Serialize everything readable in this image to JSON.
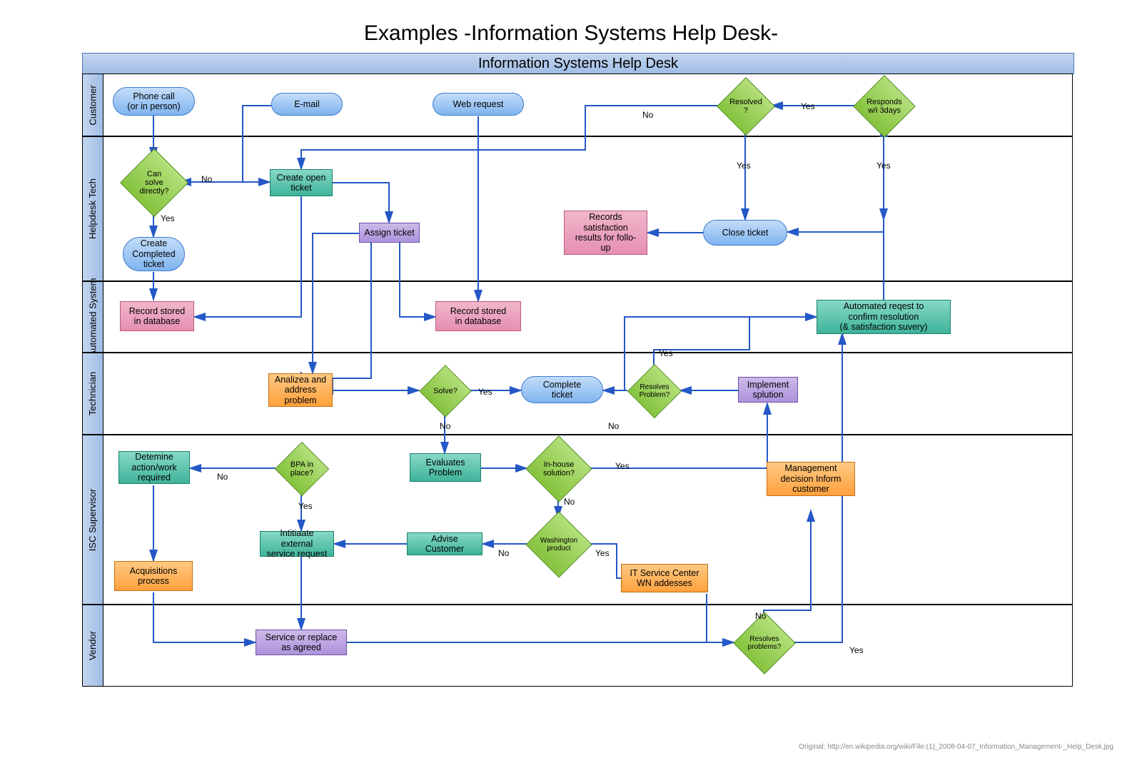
{
  "page_title": "Examples -Information Systems Help Desk-",
  "pool_title": "Information Systems Help Desk",
  "attribution": "Original: http://en.wikipedia.org/wiki/File:(1)_2008-04-07_Information_Management-_Help_Desk.jpg",
  "lanes": {
    "customer": "Customer",
    "helpdesk_tech": "Helpdesk Tech",
    "automated_system": "Automated System",
    "technician": "Technician",
    "isc_supervisor": "ISC Supervisor",
    "vendor": "Vendor"
  },
  "nodes": {
    "phone_call": "Phone call\n(or in person)",
    "email": "E-mail",
    "web_request": "Web request",
    "resolved_q": "Resolved\n?",
    "responds_3days": "Responds\nw/i 3days",
    "can_solve": "Can\nsolve\ndirectly?",
    "create_open_ticket": "Create open\nticket",
    "assign_ticket": "Assign ticket",
    "create_completed_ticket": "Create\nCompleted\nticket",
    "records_satisfaction": "Records\nsatisfaction\nresults for follo-\nup",
    "close_ticket": "Close ticket",
    "record_stored_1": "Record stored\nin database",
    "record_stored_2": "Record stored\nin database",
    "automated_request": "Automated reqest to\nconfirm resolution\n(& satisfaction suvery)",
    "analyze_problem": "Analizea and\naddress\nproblem",
    "solve_q": "Solve?",
    "complete_ticket": "Complete\nticket",
    "resolves_problem_q": "Resolves\nProblem?",
    "implement_solution": "Implement\nsplution",
    "determine_action": "Detemine\naction/work\nrequired",
    "bpa_q": "BPA in\nplace?",
    "evaluates_problem": "Evaluates\nProblem",
    "inhouse_q": "In-house\nsolution?",
    "management_decision": "Management\ndecision Inform\ncustomer",
    "initiate_request": "Intitiaate external\nservice request",
    "advise_customer": "Advise\nCustomer",
    "washington_q": "Washington\nproduct",
    "it_service_center": "IT Service Center\nWN addesses",
    "acquisitions": "Acquisitions\nprocess",
    "service_replace": "Service or replace\nas agreed",
    "resolves_problems_q": "Resolves\nproblems?"
  },
  "edge_labels": {
    "yes": "Yes",
    "no": "No"
  },
  "chart_data": {
    "type": "swimlane_flowchart",
    "nodes": [
      {
        "id": "phone_call",
        "lane": "Customer",
        "shape": "terminator",
        "label": "Phone call (or in person)"
      },
      {
        "id": "email",
        "lane": "Customer",
        "shape": "terminator",
        "label": "E-mail"
      },
      {
        "id": "web_request",
        "lane": "Customer",
        "shape": "terminator",
        "label": "Web request"
      },
      {
        "id": "resolved_q",
        "lane": "Customer",
        "shape": "decision",
        "label": "Resolved?"
      },
      {
        "id": "responds_3days",
        "lane": "Customer",
        "shape": "decision",
        "label": "Responds w/i 3days"
      },
      {
        "id": "can_solve",
        "lane": "Helpdesk Tech",
        "shape": "decision",
        "label": "Can solve directly?"
      },
      {
        "id": "create_open_ticket",
        "lane": "Helpdesk Tech",
        "shape": "process",
        "label": "Create open ticket"
      },
      {
        "id": "assign_ticket",
        "lane": "Helpdesk Tech",
        "shape": "process",
        "label": "Assign ticket"
      },
      {
        "id": "create_completed_ticket",
        "lane": "Helpdesk Tech",
        "shape": "terminator",
        "label": "Create Completed ticket"
      },
      {
        "id": "records_satisfaction",
        "lane": "Helpdesk Tech",
        "shape": "process",
        "label": "Records satisfaction results for follo-up"
      },
      {
        "id": "close_ticket",
        "lane": "Helpdesk Tech",
        "shape": "terminator",
        "label": "Close ticket"
      },
      {
        "id": "record_stored_1",
        "lane": "Automated System",
        "shape": "process",
        "label": "Record stored in database"
      },
      {
        "id": "record_stored_2",
        "lane": "Automated System",
        "shape": "process",
        "label": "Record stored in database"
      },
      {
        "id": "automated_request",
        "lane": "Automated System",
        "shape": "process",
        "label": "Automated reqest to confirm resolution (& satisfaction suvery)"
      },
      {
        "id": "analyze_problem",
        "lane": "Technician",
        "shape": "process",
        "label": "Analizea and address problem"
      },
      {
        "id": "solve_q",
        "lane": "Technician",
        "shape": "decision",
        "label": "Solve?"
      },
      {
        "id": "complete_ticket",
        "lane": "Technician",
        "shape": "terminator",
        "label": "Complete ticket"
      },
      {
        "id": "resolves_problem_q",
        "lane": "Technician",
        "shape": "decision",
        "label": "Resolves Problem?"
      },
      {
        "id": "implement_solution",
        "lane": "Technician",
        "shape": "process",
        "label": "Implement splution"
      },
      {
        "id": "determine_action",
        "lane": "ISC Supervisor",
        "shape": "process",
        "label": "Detemine action/work required"
      },
      {
        "id": "bpa_q",
        "lane": "ISC Supervisor",
        "shape": "decision",
        "label": "BPA in place?"
      },
      {
        "id": "evaluates_problem",
        "lane": "ISC Supervisor",
        "shape": "process",
        "label": "Evaluates Problem"
      },
      {
        "id": "inhouse_q",
        "lane": "ISC Supervisor",
        "shape": "decision",
        "label": "In-house solution?"
      },
      {
        "id": "management_decision",
        "lane": "ISC Supervisor",
        "shape": "process",
        "label": "Management decision Inform customer"
      },
      {
        "id": "initiate_request",
        "lane": "ISC Supervisor",
        "shape": "process",
        "label": "Intitiaate external service request"
      },
      {
        "id": "advise_customer",
        "lane": "ISC Supervisor",
        "shape": "process",
        "label": "Advise Customer"
      },
      {
        "id": "washington_q",
        "lane": "ISC Supervisor",
        "shape": "decision",
        "label": "Washington product"
      },
      {
        "id": "it_service_center",
        "lane": "ISC Supervisor",
        "shape": "process",
        "label": "IT Service Center WN addesses"
      },
      {
        "id": "acquisitions",
        "lane": "Vendor",
        "shape": "process",
        "label": "Acquisitions process"
      },
      {
        "id": "service_replace",
        "lane": "Vendor",
        "shape": "process",
        "label": "Service or replace as agreed"
      },
      {
        "id": "resolves_problems_q",
        "lane": "Vendor",
        "shape": "decision",
        "label": "Resolves problems?"
      }
    ],
    "edges": [
      {
        "from": "phone_call",
        "to": "can_solve"
      },
      {
        "from": "email",
        "to": "can_solve"
      },
      {
        "from": "can_solve",
        "to": "create_open_ticket",
        "label": "No"
      },
      {
        "from": "can_solve",
        "to": "create_completed_ticket",
        "label": "Yes"
      },
      {
        "from": "create_completed_ticket",
        "to": "record_stored_1"
      },
      {
        "from": "create_open_ticket",
        "to": "record_stored_1"
      },
      {
        "from": "create_open_ticket",
        "to": "assign_ticket"
      },
      {
        "from": "assign_ticket",
        "to": "analyze_problem"
      },
      {
        "from": "web_request",
        "to": "record_stored_2"
      },
      {
        "from": "assign_ticket",
        "to": "record_stored_2"
      },
      {
        "from": "analyze_problem",
        "to": "solve_q"
      },
      {
        "from": "solve_q",
        "to": "complete_ticket",
        "label": "Yes"
      },
      {
        "from": "solve_q",
        "to": "evaluates_problem",
        "label": "No"
      },
      {
        "from": "complete_ticket",
        "to": "automated_request"
      },
      {
        "from": "automated_request",
        "to": "responds_3days"
      },
      {
        "from": "responds_3days",
        "to": "resolved_q",
        "label": "Yes"
      },
      {
        "from": "responds_3days",
        "to": "close_ticket",
        "label": "No"
      },
      {
        "from": "resolved_q",
        "to": "close_ticket",
        "label": "Yes"
      },
      {
        "from": "resolved_q",
        "to": "create_open_ticket",
        "label": "No"
      },
      {
        "from": "close_ticket",
        "to": "records_satisfaction"
      },
      {
        "from": "evaluates_problem",
        "to": "inhouse_q"
      },
      {
        "from": "inhouse_q",
        "to": "implement_solution",
        "label": "Yes"
      },
      {
        "from": "inhouse_q",
        "to": "washington_q",
        "label": "No"
      },
      {
        "from": "implement_solution",
        "to": "resolves_problem_q"
      },
      {
        "from": "resolves_problem_q",
        "to": "automated_request",
        "label": "Yes"
      },
      {
        "from": "resolves_problem_q",
        "to": "evaluates_problem",
        "label": "No"
      },
      {
        "from": "washington_q",
        "to": "it_service_center",
        "label": "Yes"
      },
      {
        "from": "washington_q",
        "to": "advise_customer",
        "label": "No"
      },
      {
        "from": "advise_customer",
        "to": "initiate_request"
      },
      {
        "from": "bpa_q",
        "to": "initiate_request",
        "label": "Yes"
      },
      {
        "from": "bpa_q",
        "to": "determine_action",
        "label": "No"
      },
      {
        "from": "determine_action",
        "to": "acquisitions"
      },
      {
        "from": "acquisitions",
        "to": "service_replace"
      },
      {
        "from": "initiate_request",
        "to": "service_replace"
      },
      {
        "from": "service_replace",
        "to": "resolves_problems_q"
      },
      {
        "from": "it_service_center",
        "to": "resolves_problems_q"
      },
      {
        "from": "resolves_problems_q",
        "to": "automated_request",
        "label": "Yes"
      },
      {
        "from": "resolves_problems_q",
        "to": "management_decision",
        "label": "No"
      }
    ]
  }
}
